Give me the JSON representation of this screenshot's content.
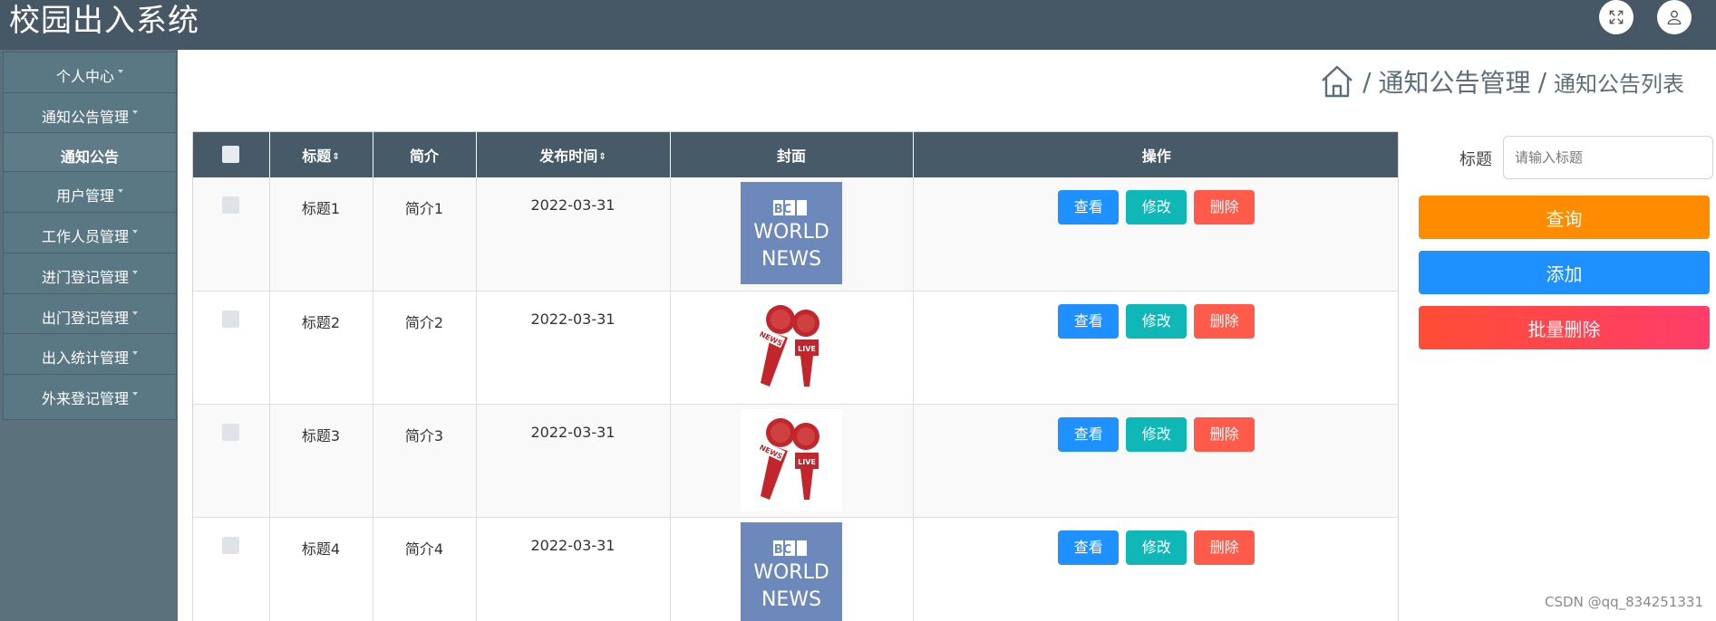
{
  "header": {
    "app_title": "校园出入系统",
    "icons": [
      "expand-icon",
      "user-icon"
    ]
  },
  "sidebar": {
    "items": [
      {
        "label": "个人中心",
        "has_caret": true
      },
      {
        "label": "通知公告管理",
        "has_caret": true
      },
      {
        "label": "通知公告",
        "has_caret": false,
        "active": true
      },
      {
        "label": "用户管理",
        "has_caret": true
      },
      {
        "label": "工作人员管理",
        "has_caret": true
      },
      {
        "label": "进门登记管理",
        "has_caret": true
      },
      {
        "label": "出门登记管理",
        "has_caret": true
      },
      {
        "label": "出入统计管理",
        "has_caret": true
      },
      {
        "label": "外来登记管理",
        "has_caret": true
      }
    ]
  },
  "breadcrumb": {
    "sep": "/",
    "level1": "通知公告管理",
    "level2": "通知公告列表"
  },
  "table": {
    "columns": {
      "title": "标题",
      "sort_mark": "⇕",
      "intro": "简介",
      "publish_time": "发布时间",
      "cover": "封面",
      "actions": "操作"
    },
    "buttons": {
      "view": "查看",
      "edit": "修改",
      "delete": "删除"
    },
    "rows": [
      {
        "title": "标题1",
        "intro": "简介1",
        "publish_time": "2022-03-31",
        "cover": "bbc"
      },
      {
        "title": "标题2",
        "intro": "简介2",
        "publish_time": "2022-03-31",
        "cover": "mic"
      },
      {
        "title": "标题3",
        "intro": "简介3",
        "publish_time": "2022-03-31",
        "cover": "mic"
      },
      {
        "title": "标题4",
        "intro": "简介4",
        "publish_time": "2022-03-31",
        "cover": "bbc"
      }
    ],
    "cover_text": {
      "bbc_line1": "BBC",
      "bbc_line2": "WORLD",
      "bbc_line3": "NEWS",
      "mic_tag1": "NEWS",
      "mic_tag2": "LIVE"
    }
  },
  "search": {
    "label": "标题",
    "placeholder": "请输入标题",
    "query_button": "查询",
    "add_button": "添加",
    "batch_delete_button": "批量删除"
  },
  "watermark": "CSDN @qq_834251331",
  "colors": {
    "header_bg": "#465866",
    "sidebar_bg": "#5b717b",
    "table_header_bg": "#475a68",
    "query": "#ff8c00",
    "add": "#1e90ff",
    "delete": "#ff5a4a",
    "edit": "#10b7b7"
  }
}
